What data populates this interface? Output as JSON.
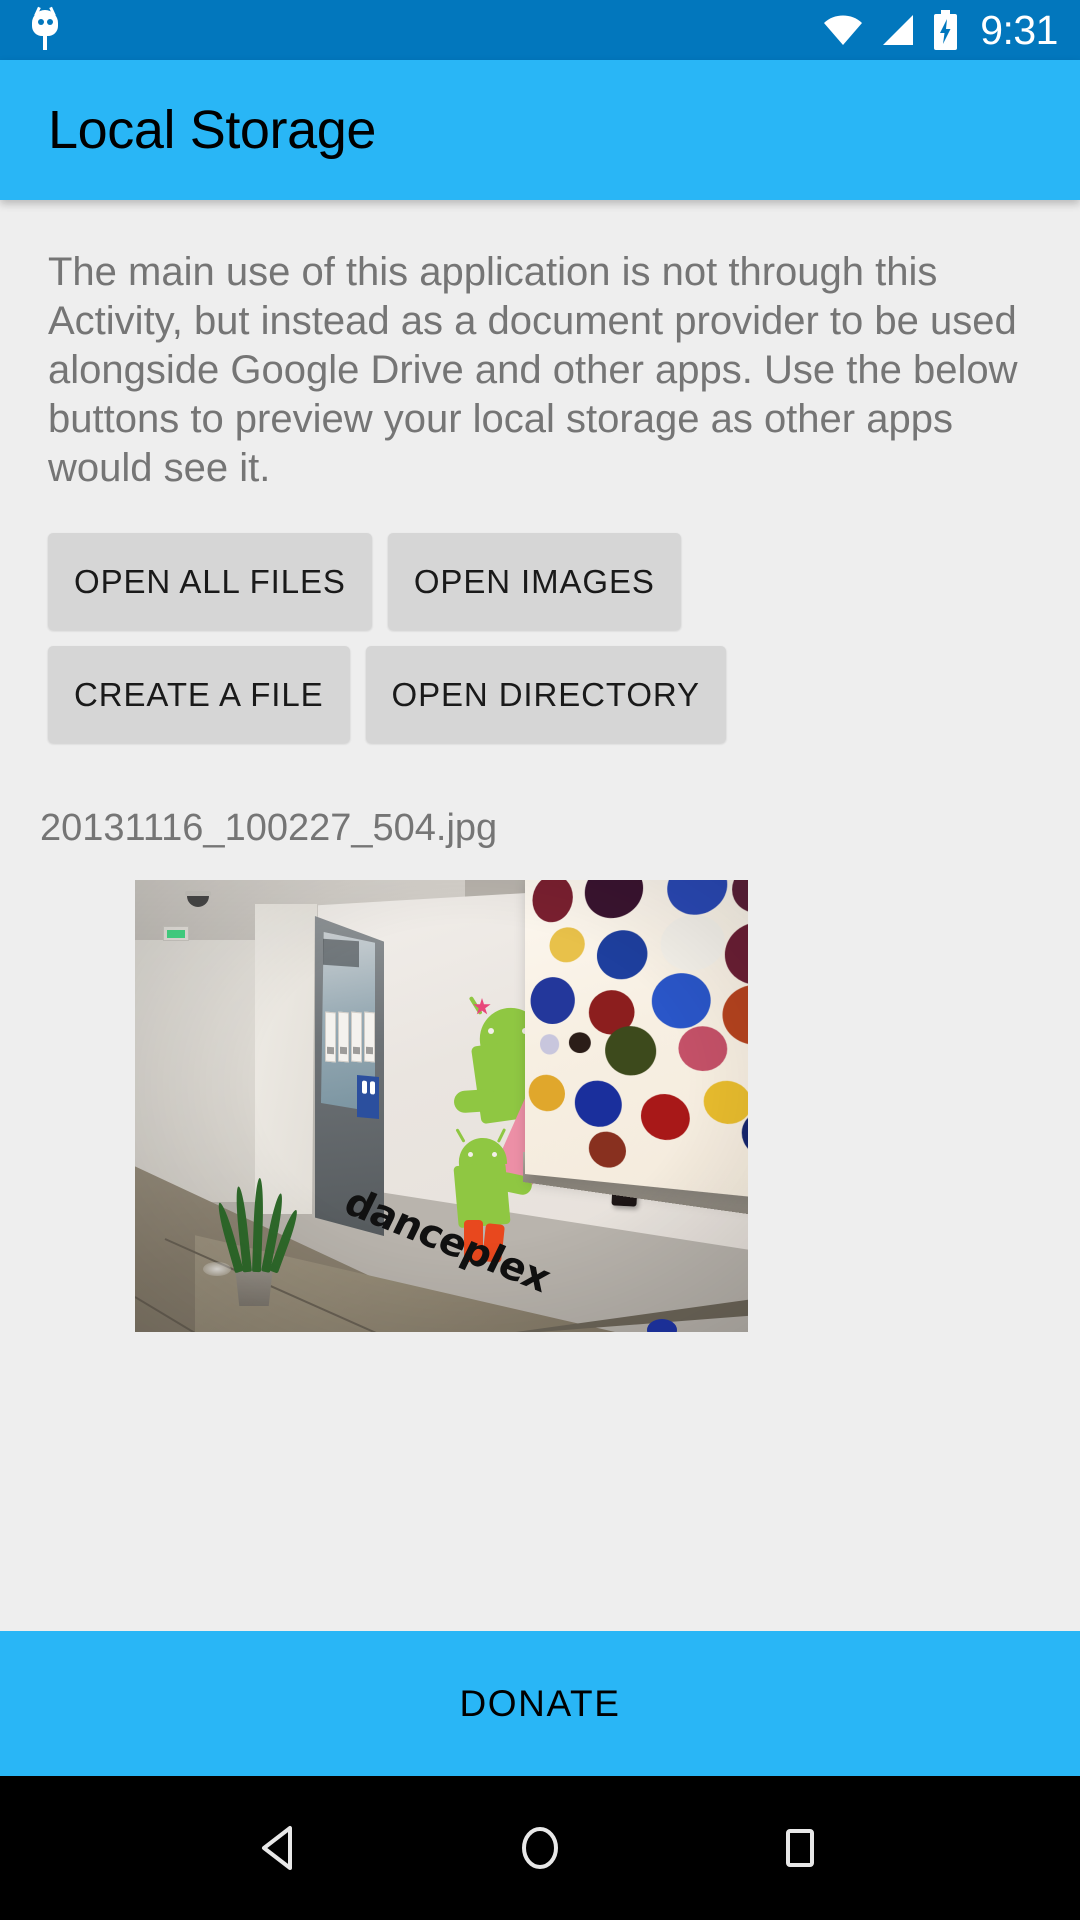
{
  "status_bar": {
    "notification_icon": "android-bug-icon",
    "wifi_icon": "wifi-icon",
    "signal_icon": "cell-signal-icon",
    "battery_icon": "battery-charging-icon",
    "time": "9:31",
    "background_color": "#0277BD"
  },
  "app_bar": {
    "title": "Local Storage",
    "background_color": "#29B6F6",
    "title_color": "#000000"
  },
  "content": {
    "description": "The main use of this application is not through this Activity, but instead as a document provider to be used alongside Google Drive and other apps. Use the below buttons to preview your local storage as other apps would see it.",
    "background_color": "#EEEEEE",
    "text_color": "#757575",
    "buttons": [
      {
        "label": "OPEN ALL FILES",
        "name": "open-all-files-button"
      },
      {
        "label": "OPEN IMAGES",
        "name": "open-images-button"
      },
      {
        "label": "CREATE A FILE",
        "name": "create-a-file-button"
      },
      {
        "label": "OPEN DIRECTORY",
        "name": "open-directory-button"
      }
    ],
    "button_color": "#D6D6D6",
    "file_name": "20131116_100227_504.jpg",
    "preview": {
      "alt": "Office hallway photo with Android mascot wall mural, polka dot painting, glass door and green stool",
      "wall_sign_text": "danceplex"
    }
  },
  "donate": {
    "label": "DONATE",
    "background_color": "#29B6F6"
  },
  "nav_bar": {
    "background_color": "#000000",
    "back_icon": "back-triangle-icon",
    "home_icon": "home-circle-icon",
    "recents_icon": "recents-square-icon"
  }
}
